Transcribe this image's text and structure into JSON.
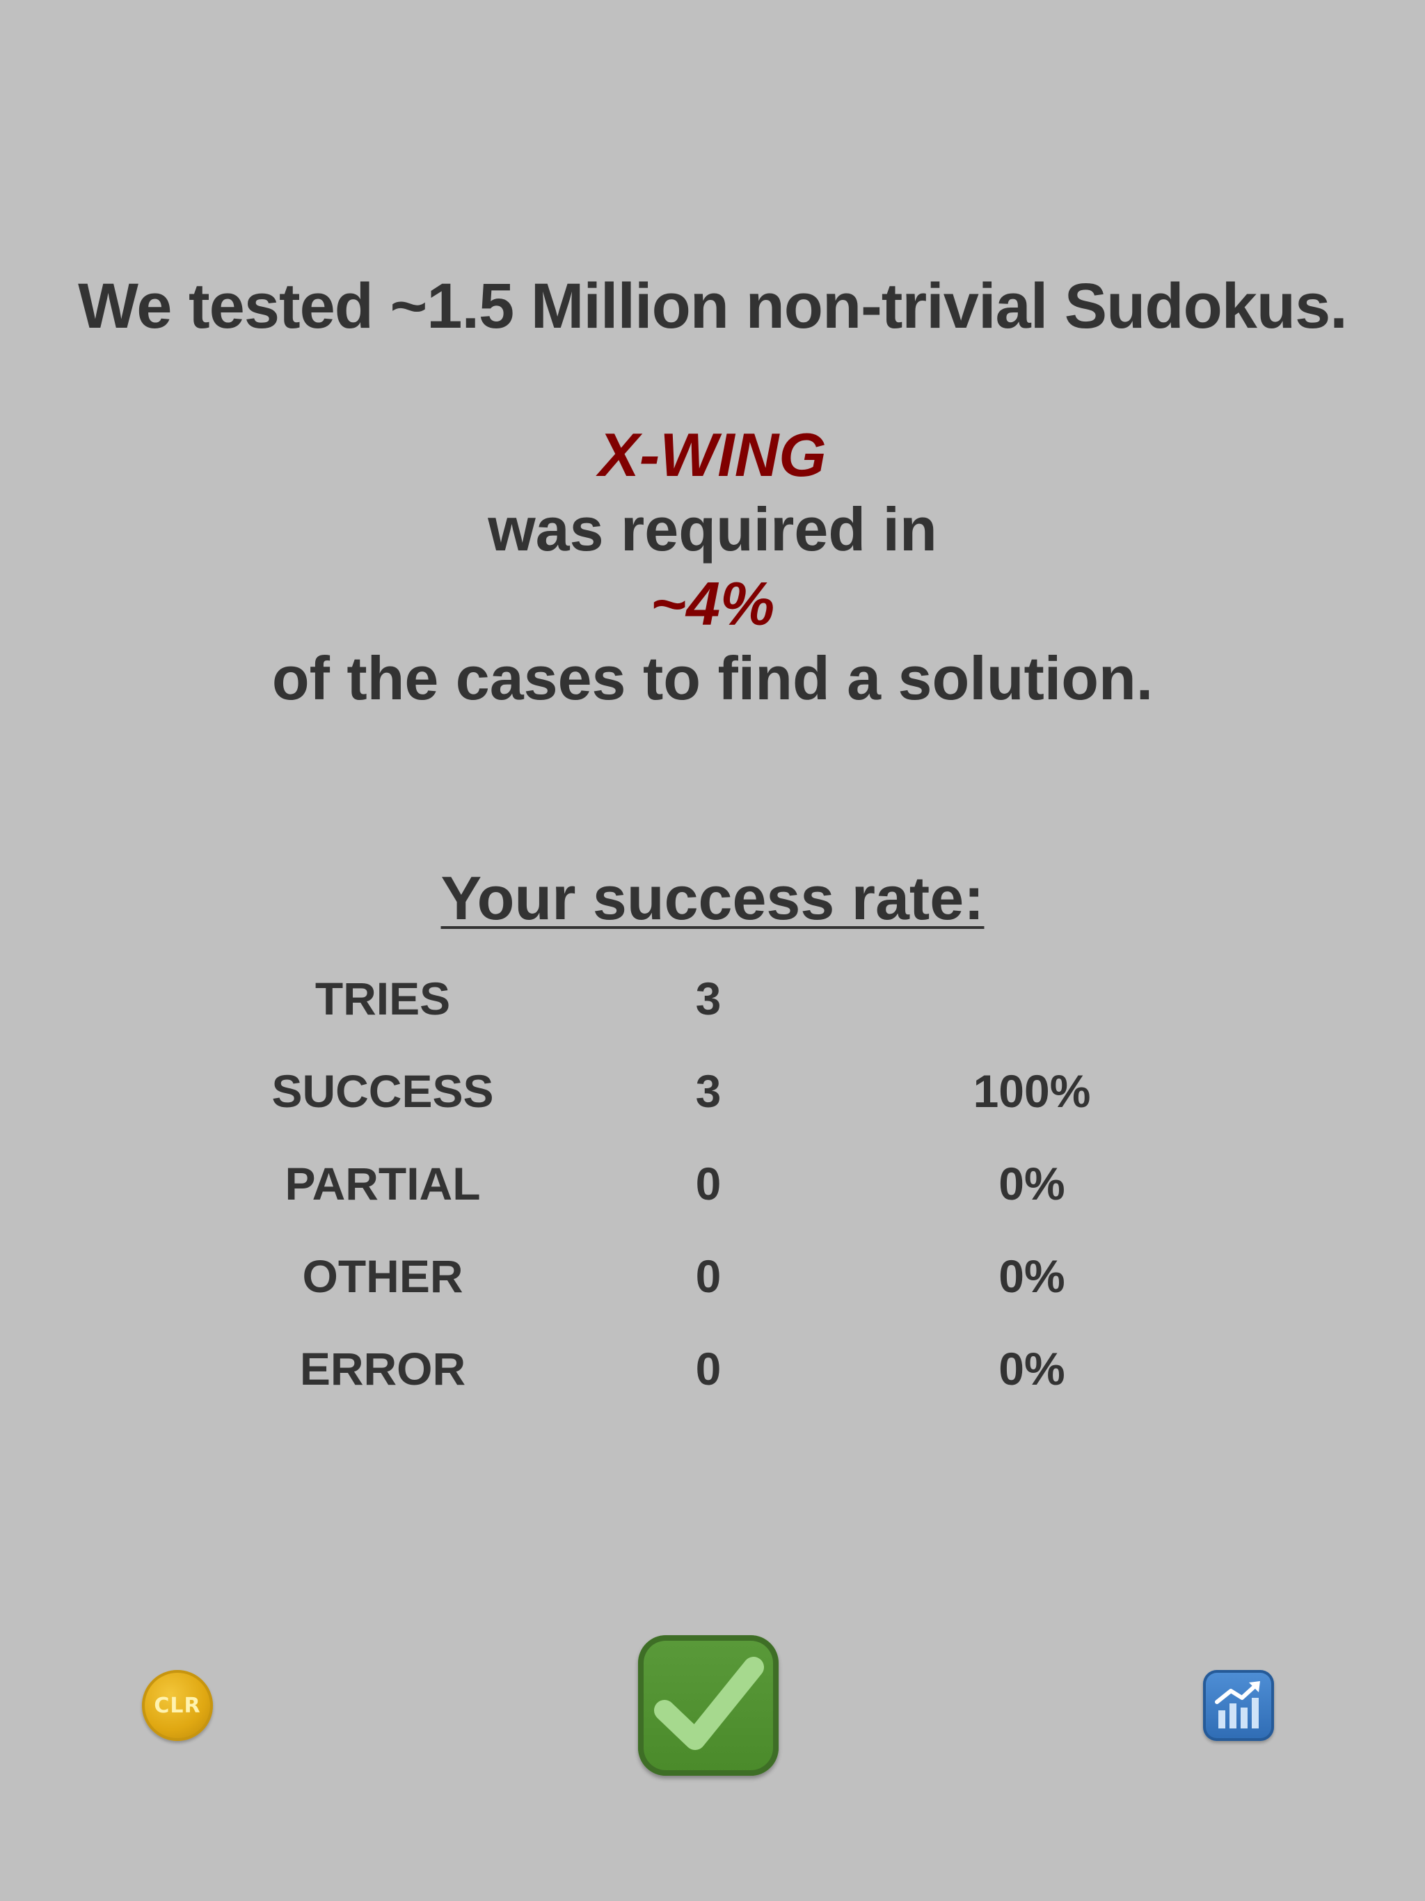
{
  "intro": {
    "headline": "We tested ~1.5 Million non-trivial Sudokus.",
    "technique": "X-WING",
    "was_required": "was required in",
    "percent": "~4%",
    "outro": "of the cases to find a solution."
  },
  "success": {
    "title": "Your success rate:",
    "rows": [
      {
        "label": "TRIES",
        "count": "3",
        "pct": ""
      },
      {
        "label": "SUCCESS",
        "count": "3",
        "pct": "100%"
      },
      {
        "label": "PARTIAL",
        "count": "0",
        "pct": "0%"
      },
      {
        "label": "OTHER",
        "count": "0",
        "pct": "0%"
      },
      {
        "label": "ERROR",
        "count": "0",
        "pct": "0%"
      }
    ]
  },
  "buttons": {
    "clear_label": "CLR",
    "confirm_icon": "checkmark-icon",
    "stats_icon": "bar-chart-icon"
  },
  "colors": {
    "background": "#c0c0c0",
    "text": "#333333",
    "accent": "#800000",
    "clear_button": "#e0a812",
    "confirm_button": "#4a8a2a",
    "stats_button": "#2f6cb4"
  }
}
